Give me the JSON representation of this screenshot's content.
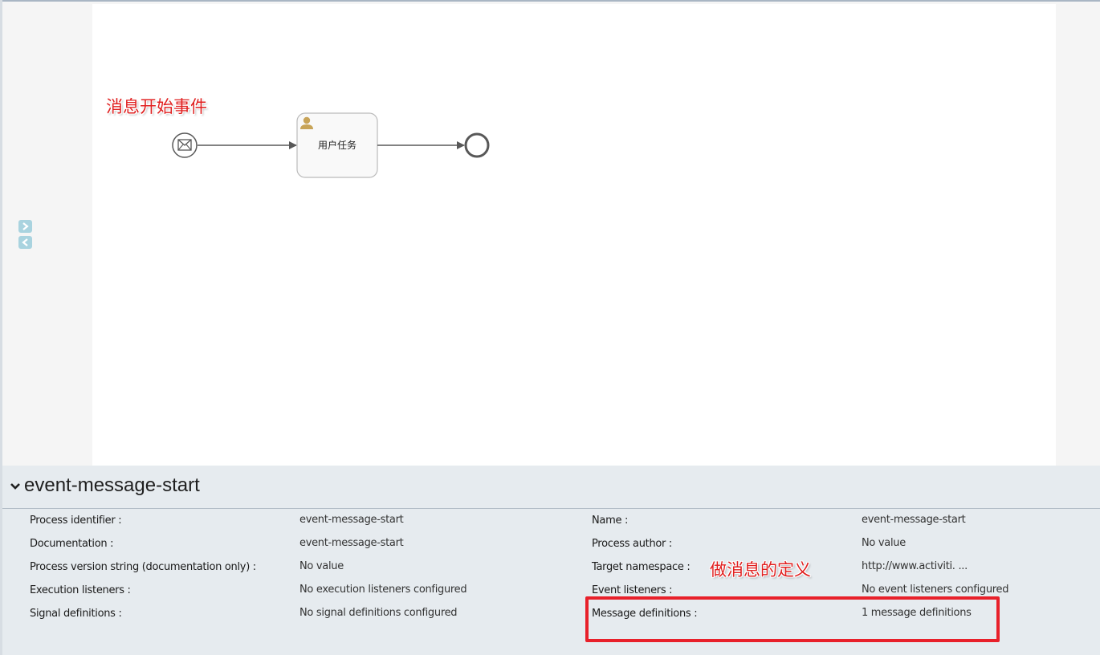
{
  "diagram": {
    "task_label": "用户任务",
    "annotation_start": "消息开始事件"
  },
  "annotation_definition": "做消息的定义",
  "panel": {
    "title": "event-message-start",
    "left_props": [
      {
        "label": "Process identifier :",
        "value": "event-message-start"
      },
      {
        "label": "Documentation :",
        "value": "event-message-start"
      },
      {
        "label": "Process version string (documentation only) :",
        "value": "No value"
      },
      {
        "label": "Execution listeners :",
        "value": "No execution listeners configured"
      },
      {
        "label": "Signal definitions :",
        "value": "No signal definitions configured"
      }
    ],
    "right_props": [
      {
        "label": "Name :",
        "value": "event-message-start"
      },
      {
        "label": "Process author :",
        "value": "No value"
      },
      {
        "label": "Target namespace :",
        "value": "http://www.activiti. ..."
      },
      {
        "label": "Event listeners :",
        "value": "No event listeners configured"
      },
      {
        "label": "Message definitions :",
        "value": "1 message definitions"
      }
    ]
  },
  "colors": {
    "annotation": "#e02020",
    "highlight_box": "#e8202a",
    "panel_bg": "#e6ebef",
    "toggle": "#a9d3df",
    "task_icon": "#c8a458"
  },
  "icons": [
    "envelope-icon",
    "user-icon",
    "chevron-down-icon",
    "chevron-right-icon",
    "chevron-left-icon"
  ]
}
